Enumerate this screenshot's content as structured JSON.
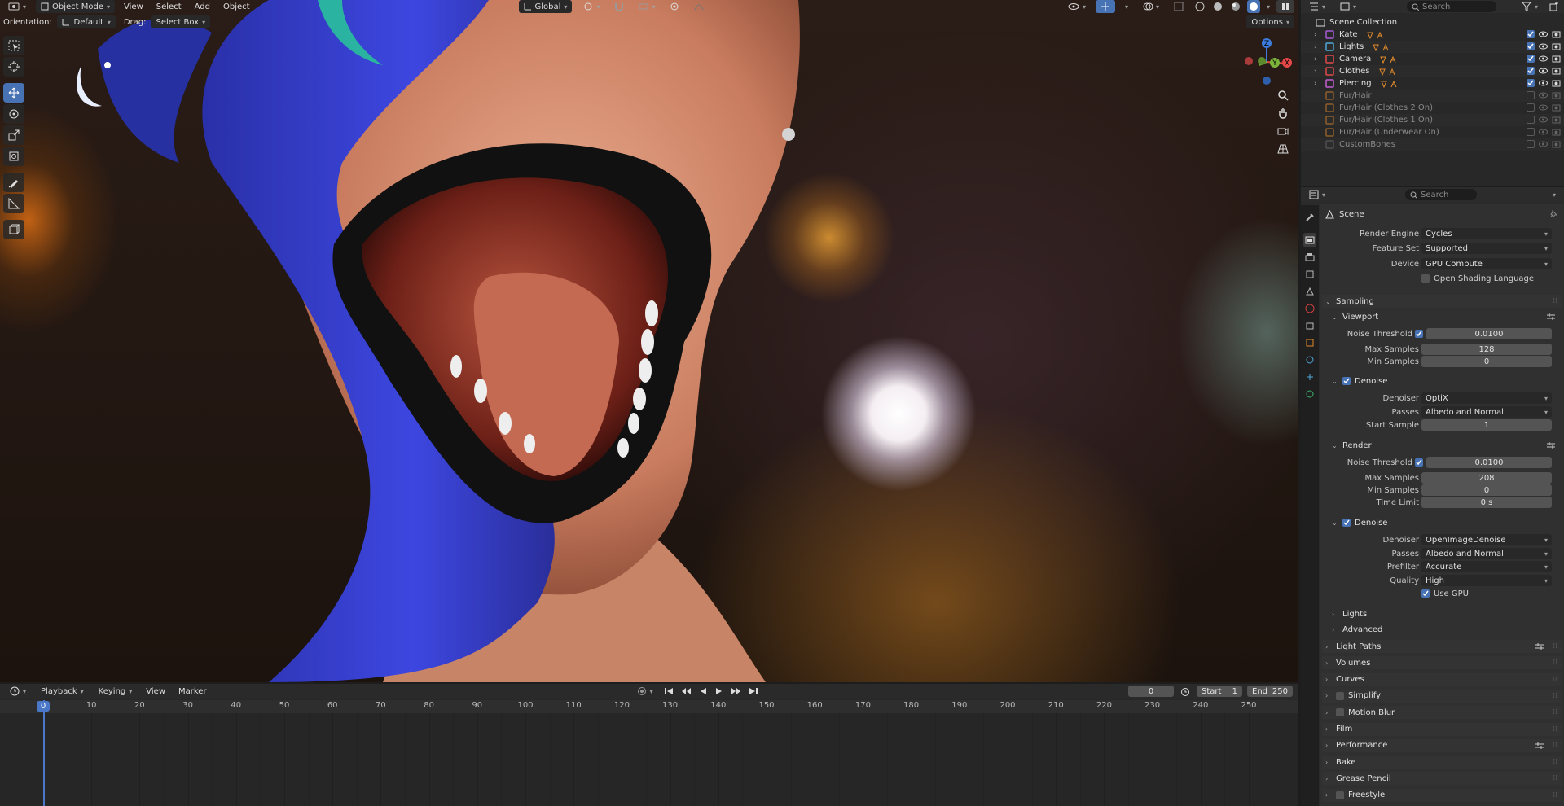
{
  "viewport": {
    "mode": "Object Mode",
    "menus": [
      "View",
      "Select",
      "Add",
      "Object"
    ],
    "transform_orientation": "Global",
    "orientation_label": "Orientation:",
    "orientation_value": "Default",
    "drag_label": "Drag:",
    "drag_value": "Select Box",
    "options_label": "Options",
    "gizmo_axes": {
      "x": "X",
      "y": "Y",
      "z": "Z"
    },
    "colors": {
      "x_axis": "#e54848",
      "y_axis": "#7bb33b",
      "z_axis": "#3d7de0",
      "active_tool": "#4772b3"
    }
  },
  "timeline": {
    "menus": [
      "Playback",
      "Keying",
      "View",
      "Marker"
    ],
    "current_frame": "0",
    "start_label": "Start",
    "start_value": "1",
    "end_label": "End",
    "end_value": "250",
    "playhead_frame": "0",
    "ruler_ticks": [
      "10",
      "20",
      "30",
      "40",
      "50",
      "60",
      "70",
      "80",
      "90",
      "100",
      "110",
      "120",
      "130",
      "140",
      "150",
      "160",
      "170",
      "180",
      "190",
      "200",
      "210",
      "220",
      "230",
      "240",
      "250"
    ]
  },
  "outliner": {
    "search_placeholder": "Search",
    "root": "Scene Collection",
    "items": [
      {
        "name": "Kate",
        "color": "#a45bd6",
        "enabled": true
      },
      {
        "name": "Lights",
        "color": "#4fa7d8",
        "enabled": true
      },
      {
        "name": "Camera",
        "color": "#e04b4b",
        "enabled": true
      },
      {
        "name": "Clothes",
        "color": "#e04b4b",
        "enabled": true
      },
      {
        "name": "Piercing",
        "color": "#c35fd1",
        "enabled": true
      },
      {
        "name": "Fur/Hair",
        "color": "#e08a2b",
        "enabled": false
      },
      {
        "name": "Fur/Hair (Clothes 2 On)",
        "color": "#e08a2b",
        "enabled": false
      },
      {
        "name": "Fur/Hair (Clothes 1 On)",
        "color": "#e08a2b",
        "enabled": false
      },
      {
        "name": "Fur/Hair (Underwear On)",
        "color": "#e08a2b",
        "enabled": false
      },
      {
        "name": "CustomBones",
        "color": "#6d6d6d",
        "enabled": false
      }
    ]
  },
  "properties": {
    "search_placeholder": "Search",
    "context": "Scene",
    "render_engine_label": "Render Engine",
    "render_engine": "Cycles",
    "feature_set_label": "Feature Set",
    "feature_set": "Supported",
    "device_label": "Device",
    "device": "GPU Compute",
    "osl_label": "Open Shading Language",
    "sampling": "Sampling",
    "viewport_section": "Viewport",
    "viewport_noise_label": "Noise Threshold",
    "viewport_noise": "0.0100",
    "viewport_max_label": "Max Samples",
    "viewport_max": "128",
    "viewport_min_label": "Min Samples",
    "viewport_min": "0",
    "viewport_denoise": "Denoise",
    "viewport_denoiser_label": "Denoiser",
    "viewport_denoiser": "OptiX",
    "viewport_passes_label": "Passes",
    "viewport_passes": "Albedo and Normal",
    "viewport_start_label": "Start Sample",
    "viewport_start": "1",
    "render_section": "Render",
    "render_noise_label": "Noise Threshold",
    "render_noise": "0.0100",
    "render_max_label": "Max Samples",
    "render_max": "208",
    "render_min_label": "Min Samples",
    "render_min": "0",
    "render_time_label": "Time Limit",
    "render_time": "0 s",
    "render_denoise": "Denoise",
    "render_denoiser_label": "Denoiser",
    "render_denoiser": "OpenImageDenoise",
    "render_passes_label": "Passes",
    "render_passes": "Albedo and Normal",
    "prefilter_label": "Prefilter",
    "prefilter": "Accurate",
    "quality_label": "Quality",
    "quality": "High",
    "use_gpu": "Use GPU",
    "lights": "Lights",
    "advanced": "Advanced",
    "panels": [
      "Light Paths",
      "Volumes",
      "Curves",
      "Simplify",
      "Motion Blur",
      "Film",
      "Performance",
      "Bake",
      "Grease Pencil",
      "Freestyle"
    ]
  }
}
